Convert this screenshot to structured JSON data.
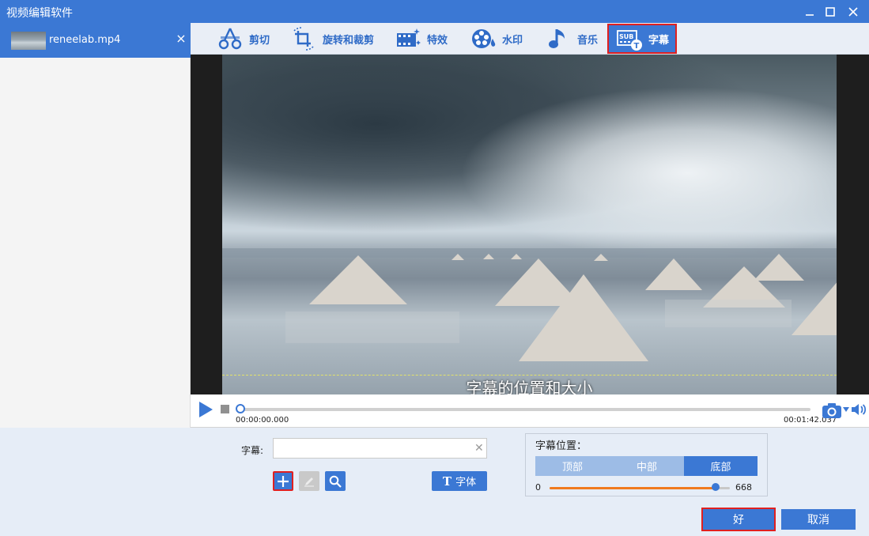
{
  "app": {
    "title": "视频编辑软件"
  },
  "window_controls": [
    "minimize-icon",
    "maximize-icon",
    "close-icon"
  ],
  "files": [
    {
      "name": "reneelab.mp4"
    }
  ],
  "toolbar": {
    "tabs": [
      {
        "label": "剪切",
        "icon": "cut-icon"
      },
      {
        "label": "旋转和裁剪",
        "icon": "rotate-crop-icon"
      },
      {
        "label": "特效",
        "icon": "effects-icon"
      },
      {
        "label": "水印",
        "icon": "watermark-icon"
      },
      {
        "label": "音乐",
        "icon": "music-icon"
      },
      {
        "label": "字幕",
        "icon": "subtitle-icon",
        "active": true
      }
    ]
  },
  "preview": {
    "subtitle_preview_text": "字幕的位置和大小"
  },
  "player": {
    "current_time": "00:00:00.000",
    "total_time": "00:01:42.037",
    "progress": 0
  },
  "subtitle_editor": {
    "label": "字幕:",
    "value": "",
    "font_button": "字体"
  },
  "subtitle_position": {
    "title": "字幕位置：",
    "options": [
      "顶部",
      "中部",
      "底部"
    ],
    "selected": "底部",
    "slider_min": "0",
    "slider_max": "668",
    "slider_value_fraction": 0.92
  },
  "actions": {
    "ok": "好",
    "cancel": "取消"
  },
  "colors": {
    "accent": "#3b78d4",
    "highlight_border": "#e02020",
    "slider_fill": "#f07a1e"
  }
}
